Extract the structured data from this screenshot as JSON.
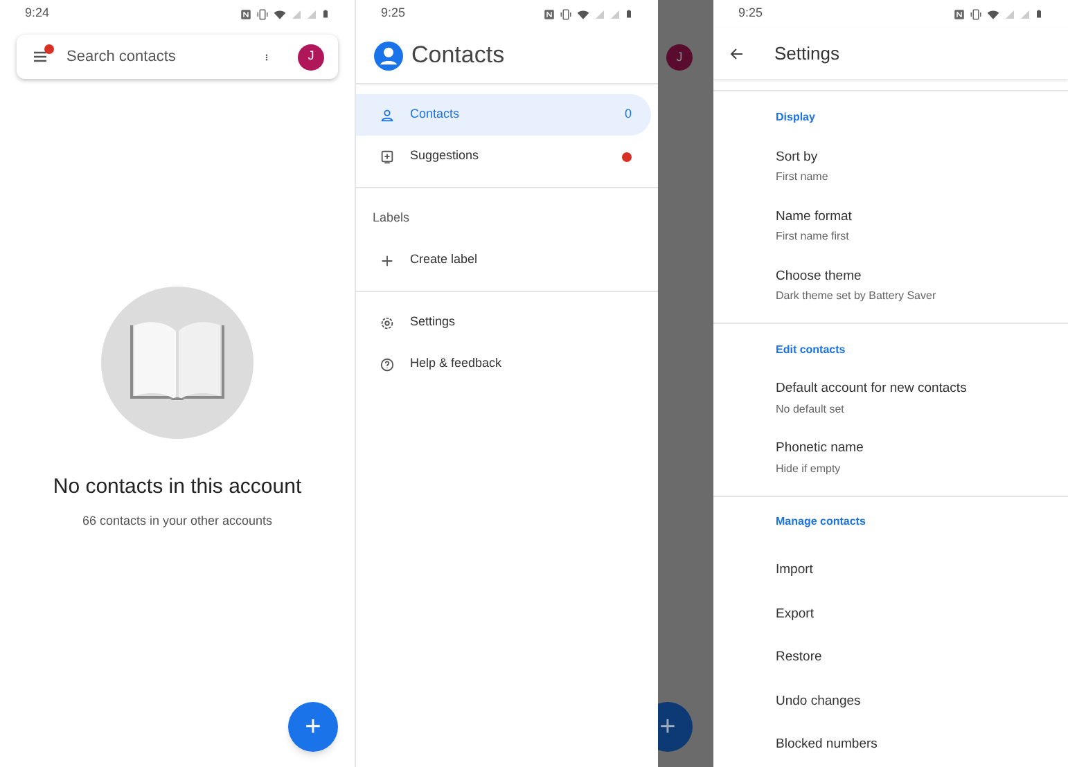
{
  "contacts_screen": {
    "status_time": "9:24",
    "search": {
      "placeholder": "Search contacts",
      "menu_badge": true
    },
    "avatar": "J",
    "empty_title": "No contacts in this account",
    "empty_subtitle": "66 contacts in your other accounts",
    "fab": "+"
  },
  "drawer_screen": {
    "status_time": "9:25",
    "title": "Contacts",
    "items": [
      {
        "kind": "nav",
        "label": "Contacts",
        "count": "0",
        "badge": false,
        "selected": true
      },
      {
        "kind": "nav",
        "label": "Suggestions",
        "badge": true,
        "selected": false
      },
      {
        "kind": "divider"
      },
      {
        "kind": "header",
        "label": "Labels"
      },
      {
        "kind": "nav",
        "label": "Create label",
        "badge": false,
        "selected": false
      },
      {
        "kind": "divider"
      },
      {
        "kind": "nav",
        "label": "Settings",
        "badge": false,
        "selected": false
      },
      {
        "kind": "nav",
        "label": "Help & feedback",
        "badge": false,
        "selected": false
      }
    ],
    "behind_avatar": "J",
    "behind_fab": "+"
  },
  "settings_screen": {
    "status_time": "9:25",
    "title": "Settings",
    "sections": [
      {
        "header": "Display",
        "items": [
          {
            "title": "Sort by",
            "subtitle": "First name"
          },
          {
            "title": "Name format",
            "subtitle": "First name first"
          },
          {
            "title": "Choose theme",
            "subtitle": "Dark theme set by Battery Saver"
          }
        ]
      },
      {
        "header": "Edit contacts",
        "items": [
          {
            "title": "Default account for new contacts",
            "subtitle": "No default set"
          },
          {
            "title": "Phonetic name",
            "subtitle": "Hide if empty"
          }
        ]
      },
      {
        "header": "Manage contacts",
        "items": [
          {
            "title": "Import"
          },
          {
            "title": "Export"
          },
          {
            "title": "Restore"
          },
          {
            "title": "Undo changes"
          },
          {
            "title": "Blocked numbers"
          }
        ]
      }
    ]
  }
}
